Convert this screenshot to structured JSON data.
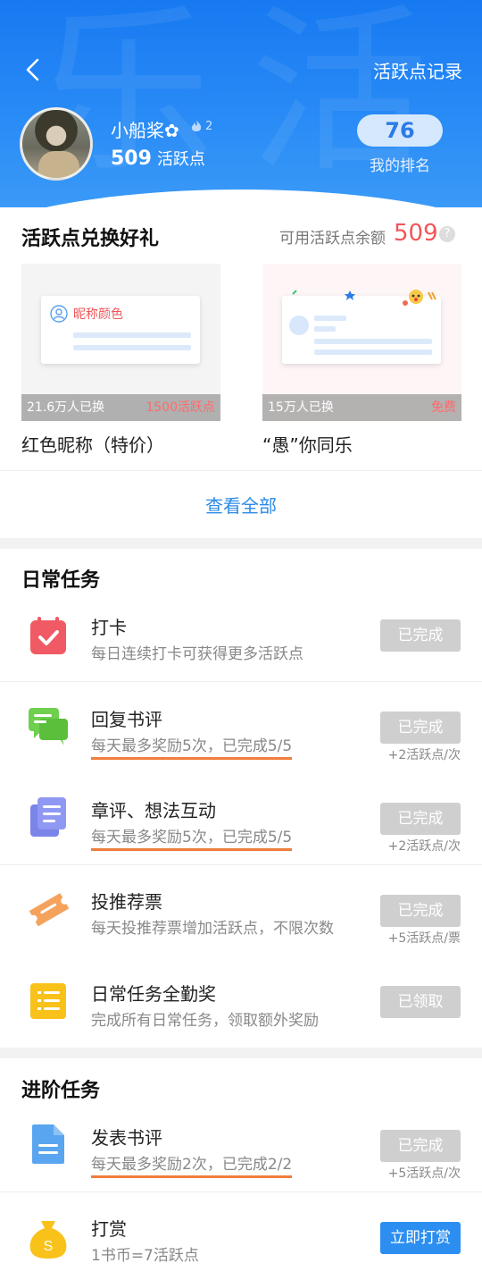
{
  "header": {
    "back_icon": "back-arrow-icon",
    "record_link": "活跃点记录",
    "username": "小船桨✿",
    "level": "2",
    "points_value": "509",
    "points_unit": "活跃点",
    "rank_value": "76",
    "rank_label": "我的排名",
    "colors": {
      "header_bg": "#1779f1",
      "rank_pill": "#d6e8fd"
    }
  },
  "rewards": {
    "title": "活跃点兑换好礼",
    "balance_label": "可用活跃点余额",
    "balance_value": "509",
    "help_icon": "?",
    "items": [
      {
        "preview_label": "昵称颜色",
        "exchanged": "21.6万人已换",
        "cost": "1500活跃点",
        "name": "红色昵称（特价）"
      },
      {
        "preview_label": "",
        "exchanged": "15万人已换",
        "cost": "免费",
        "name": "“愚”你同乐"
      }
    ],
    "see_all": "查看全部"
  },
  "daily": {
    "title": "日常任务",
    "tasks": [
      {
        "icon": "calendar-check-icon",
        "title": "打卡",
        "desc": "每日连续打卡可获得更多活跃点",
        "button": "已完成",
        "reward": ""
      },
      {
        "icon": "chat-bubbles-icon",
        "title": "回复书评",
        "desc": "每天最多奖励5次，已完成5/5",
        "button": "已完成",
        "reward": "+2活跃点/次"
      },
      {
        "icon": "stacked-document-icon",
        "title": "章评、想法互动",
        "desc": "每天最多奖励5次，已完成5/5",
        "button": "已完成",
        "reward": "+2活跃点/次"
      },
      {
        "icon": "ticket-icon",
        "title": "投推荐票",
        "desc": "每天投推荐票增加活跃点，不限次数",
        "button": "已完成",
        "reward": "+5活跃点/票"
      },
      {
        "icon": "checklist-icon",
        "title": "日常任务全勤奖",
        "desc": "完成所有日常任务，领取额外奖励",
        "button": "已领取",
        "reward": ""
      }
    ]
  },
  "advanced": {
    "title": "进阶任务",
    "tasks": [
      {
        "icon": "document-icon",
        "title": "发表书评",
        "desc": "每天最多奖励2次，已完成2/2",
        "button": "已完成",
        "reward": "+5活跃点/次"
      },
      {
        "icon": "money-bag-icon",
        "title": "打赏",
        "desc": "1书币=7活跃点",
        "button": "立即打赏",
        "reward": ""
      }
    ]
  }
}
